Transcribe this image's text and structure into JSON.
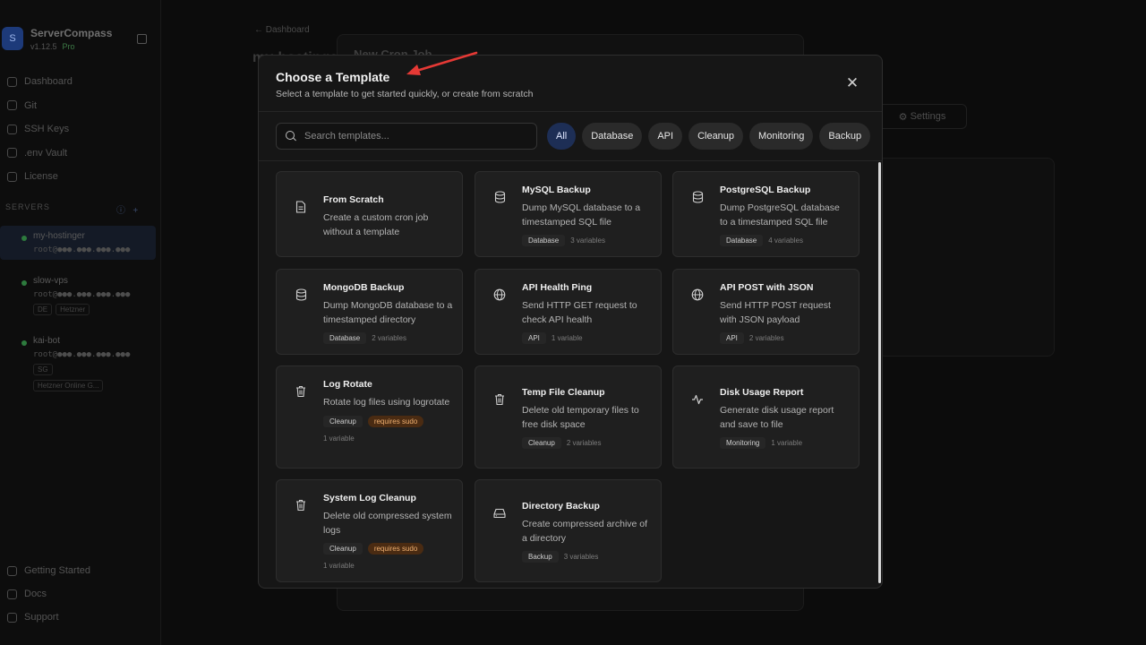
{
  "app": {
    "name": "ServerCompass",
    "version": "v1.12.5",
    "plan": "Pro",
    "logo_glyph": "S"
  },
  "sidebar": {
    "nav": [
      {
        "label": "Dashboard",
        "icon": "home-icon"
      },
      {
        "label": "Git",
        "icon": "git-icon"
      },
      {
        "label": "SSH Keys",
        "icon": "key-icon"
      },
      {
        "label": ".env Vault",
        "icon": "lock-icon"
      },
      {
        "label": "License",
        "icon": "shield-icon"
      }
    ],
    "servers_label": "SERVERS",
    "servers": [
      {
        "name": "my-hostinger",
        "addr": "root@●●●.●●●.●●●.●●●",
        "tags": []
      },
      {
        "name": "slow-vps",
        "addr": "root@●●●.●●●.●●●.●●●",
        "tags": [
          "DE",
          "Hetzner"
        ]
      },
      {
        "name": "kai-bot",
        "addr": "root@●●●.●●●.●●●.●●●",
        "tags": [
          "SG",
          "Hetzner Online G..."
        ]
      }
    ],
    "bottom": [
      {
        "label": "Getting Started",
        "icon": "sparkle-icon"
      },
      {
        "label": "Docs",
        "icon": "book-icon"
      },
      {
        "label": "Support",
        "icon": "chat-icon"
      }
    ]
  },
  "background": {
    "breadcrumb": "← Dashboard",
    "page_title": "my-hostinger",
    "panel_title": "New Cron Job",
    "settings_label": "Settings"
  },
  "modal": {
    "title": "Choose a Template",
    "subtitle": "Select a template to get started quickly, or create from scratch",
    "search_placeholder": "Search templates...",
    "filters": [
      "All",
      "Database",
      "API",
      "Cleanup",
      "Monitoring",
      "Backup"
    ],
    "active_filter": "All",
    "templates": [
      {
        "name": "From Scratch",
        "desc": "Create a custom cron job without a template",
        "icon": "file-icon",
        "category": "",
        "vars": "",
        "sudo": ""
      },
      {
        "name": "MySQL Backup",
        "desc": "Dump MySQL database to a timestamped SQL file",
        "icon": "database-icon",
        "category": "Database",
        "vars": "3 variables",
        "sudo": ""
      },
      {
        "name": "PostgreSQL Backup",
        "desc": "Dump PostgreSQL database to a timestamped SQL file",
        "icon": "database-icon",
        "category": "Database",
        "vars": "4 variables",
        "sudo": ""
      },
      {
        "name": "MongoDB Backup",
        "desc": "Dump MongoDB database to a timestamped directory",
        "icon": "database-icon",
        "category": "Database",
        "vars": "2 variables",
        "sudo": ""
      },
      {
        "name": "API Health Ping",
        "desc": "Send HTTP GET request to check API health",
        "icon": "globe-icon",
        "category": "API",
        "vars": "1 variable",
        "sudo": ""
      },
      {
        "name": "API POST with JSON",
        "desc": "Send HTTP POST request with JSON payload",
        "icon": "globe-icon",
        "category": "API",
        "vars": "2 variables",
        "sudo": ""
      },
      {
        "name": "Log Rotate",
        "desc": "Rotate log files using logrotate",
        "icon": "trash-icon",
        "category": "Cleanup",
        "vars": "1 variable",
        "sudo": "requires sudo"
      },
      {
        "name": "Temp File Cleanup",
        "desc": "Delete old temporary files to free disk space",
        "icon": "trash-icon",
        "category": "Cleanup",
        "vars": "2 variables",
        "sudo": ""
      },
      {
        "name": "Disk Usage Report",
        "desc": "Generate disk usage report and save to file",
        "icon": "activity-icon",
        "category": "Monitoring",
        "vars": "1 variable",
        "sudo": ""
      },
      {
        "name": "System Log Cleanup",
        "desc": "Delete old compressed system logs",
        "icon": "trash-icon",
        "category": "Cleanup",
        "vars": "1 variable",
        "sudo": "requires sudo"
      },
      {
        "name": "Directory Backup",
        "desc": "Create compressed archive of a directory",
        "icon": "hard-drive-icon",
        "category": "Backup",
        "vars": "3 variables",
        "sudo": ""
      }
    ]
  },
  "colors": {
    "accent": "#1d2e55",
    "modal_bg": "#161616",
    "card_bg": "#1f1f1f",
    "sudo_badge": "#4a2b12",
    "annotation_arrow": "#e53935",
    "online_dot": "#2d7a3d"
  }
}
